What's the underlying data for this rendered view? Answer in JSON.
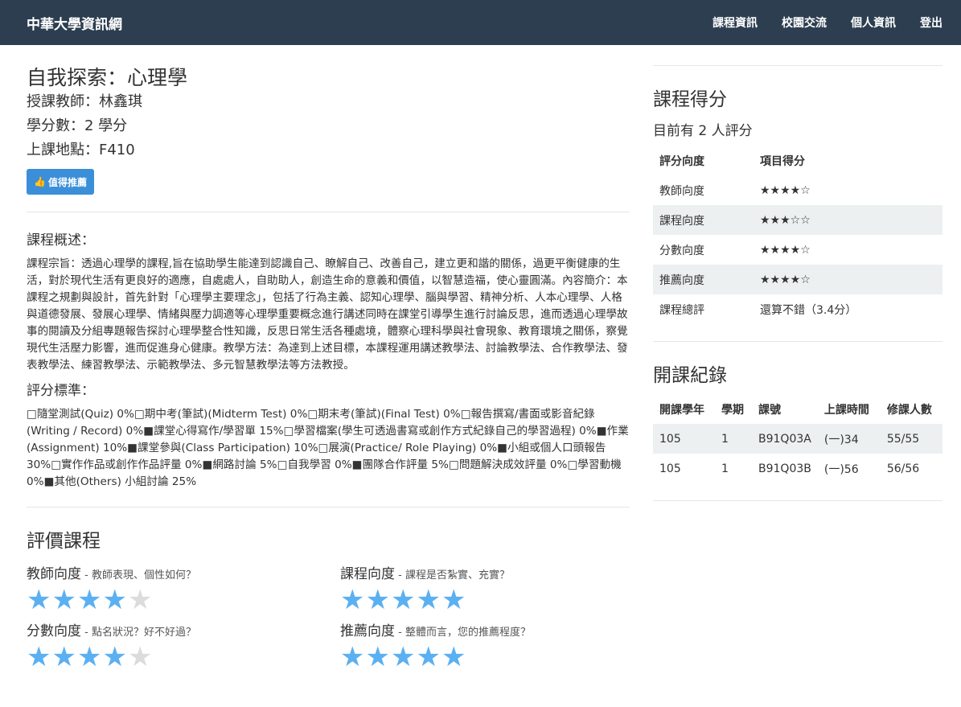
{
  "nav": {
    "brand": "中華大學資訊網",
    "links": [
      "課程資訊",
      "校園交流",
      "個人資訊",
      "登出"
    ]
  },
  "course": {
    "title": "自我探索：心理學",
    "teacher": "授課教師：林鑫琪",
    "credits": "學分數：2 學分",
    "location": "上課地點：F410",
    "recommend_button": "值得推薦"
  },
  "overview": {
    "heading": "課程概述：",
    "text": "課程宗旨：透過心理學的課程,旨在協助學生能達到認識自己、瞭解自己、改善自己，建立更和諧的關係，過更平衡健康的生活，對於現代生活有更良好的適應，自處處人，自助助人，創造生命的意義和價值，以智慧造福，使心靈圓滿。內容簡介：本課程之規劃與設計，首先針對「心理學主要理念」，包括了行為主義、認知心理學、腦與學習、精神分析、人本心理學、人格與道德發展、發展心理學、情緒與壓力調適等心理學重要概念進行講述同時在課堂引導學生進行討論反思，進而透過心理學故事的閱讀及分組專題報告探討心理學整合性知識，反思日常生活各種處境，體察心理科學與社會現象、教育環境之關係，察覺現代生活壓力影響，進而促進身心健康。教學方法：為達到上述目標，本課程運用講述教學法、討論教學法、合作教學法、發表教學法、練習教學法、示範教學法、多元智慧教學法等方法教授。"
  },
  "grading": {
    "heading": "評分標準：",
    "text": "□隨堂測試(Quiz) 0%□期中考(筆試)(Midterm Test) 0%□期末考(筆試)(Final Test) 0%□報告撰寫/書面或影音紀錄(Writing / Record) 0%■課堂心得寫作/學習單 15%□學習檔案(學生可透過書寫或創作方式紀錄自己的學習過程) 0%■作業 (Assignment) 10%■課堂參與(Class Participation) 10%□展演(Practice/ Role Playing) 0%■小組或個人口頭報告 30%□實作作品或創作作品評量 0%■網路討論 5%□自我學習 0%■團隊合作評量 5%□問題解決成效評量 0%□學習動機 0%■其他(Others) 小組討論 25%"
  },
  "evaluate": {
    "heading": "評價課程",
    "items": [
      {
        "label": "教師向度",
        "sub": " - 教師表現、個性如何？",
        "stars": 4
      },
      {
        "label": "課程向度",
        "sub": " - 課程是否紮實、充實？",
        "stars": 5
      },
      {
        "label": "分數向度",
        "sub": " - 點名狀況？好不好過？",
        "stars": 4
      },
      {
        "label": "推薦向度",
        "sub": " - 整體而言，您的推薦程度？",
        "stars": 5
      }
    ]
  },
  "score": {
    "heading": "課程得分",
    "count_text": "目前有 2 人評分",
    "headers": [
      "評分向度",
      "項目得分"
    ],
    "rows": [
      [
        "教師向度",
        "★★★★☆"
      ],
      [
        "課程向度",
        "★★★☆☆"
      ],
      [
        "分數向度",
        "★★★★☆"
      ],
      [
        "推薦向度",
        "★★★★☆"
      ],
      [
        "課程總評",
        "還算不錯（3.4分）"
      ]
    ]
  },
  "records": {
    "heading": "開課紀錄",
    "headers": [
      "開課學年",
      "學期",
      "課號",
      "上課時間",
      "修課人數"
    ],
    "rows": [
      [
        "105",
        "1",
        "B91Q03A",
        "(一)34",
        "55/55"
      ],
      [
        "105",
        "1",
        "B91Q03B",
        "(一)56",
        "56/56"
      ]
    ]
  }
}
